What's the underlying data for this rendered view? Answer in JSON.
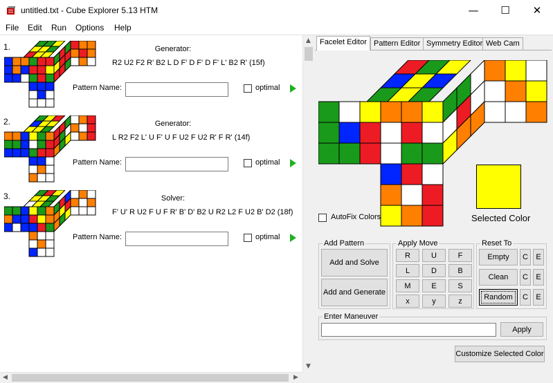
{
  "window": {
    "title": "untitled.txt - Cube Explorer 5.13 HTM",
    "minimize": "—",
    "maximize": "☐",
    "close": "✕"
  },
  "menu": [
    "File",
    "Edit",
    "Run",
    "Options",
    "Help"
  ],
  "colors": {
    "U": "#ffff00",
    "R": "#ed1c24",
    "F": "#1a9a1a",
    "D": "#ffffff",
    "L": "#ff7f00",
    "B": "#0025ff"
  },
  "patterns": [
    {
      "number": "1.",
      "kind": "Generator:",
      "moves": "R2 U2 F2 R' B2 L D F' D F' D F' L' B2 R'  (15f)",
      "name_label": "Pattern Name:",
      "name_value": "",
      "optimal_label": "optimal",
      "optimal_checked": false,
      "preview": {
        "left": [
          "B",
          "O",
          "O",
          "B",
          "O",
          "B",
          "B",
          "B",
          "W"
        ],
        "front": [
          "G",
          "R",
          "R",
          "R",
          "R",
          "Y",
          "G",
          "R",
          "G"
        ],
        "right": [
          "R",
          "O",
          "O",
          "O",
          "R",
          "O",
          "W",
          "O",
          "W"
        ],
        "top": [
          "G",
          "G",
          "Y",
          "Y",
          "Y",
          "G",
          "R",
          "Y",
          "Y"
        ],
        "down": [
          "B",
          "B",
          "B",
          "W",
          "B",
          "W",
          "W",
          "W",
          "W"
        ]
      }
    },
    {
      "number": "2.",
      "kind": "Generator:",
      "moves": "L R2 F2 L' U F' U F U2 F U2 R' F R'  (14f)",
      "name_label": "Pattern Name:",
      "name_value": "",
      "optimal_label": "optimal",
      "optimal_checked": false,
      "preview": {
        "left": [
          "O",
          "O",
          "B",
          "G",
          "G",
          "B",
          "B",
          "B",
          "B"
        ],
        "front": [
          "Y",
          "G",
          "O",
          "W",
          "G",
          "R",
          "G",
          "R",
          "R"
        ],
        "right": [
          "W",
          "O",
          "R",
          "O",
          "W",
          "R",
          "W",
          "O",
          "R"
        ],
        "top": [
          "G",
          "Y",
          "R",
          "B",
          "Y",
          "Y",
          "Y",
          "Y",
          "G"
        ],
        "down": [
          "B",
          "B",
          "W",
          "W",
          "O",
          "W",
          "O",
          "W",
          "W"
        ]
      }
    },
    {
      "number": "3.",
      "kind": "Solver:",
      "moves": "F' U' R U2 F U F R' B' D' B2 U R2 L2 F U2 B' D2  (18f)",
      "name_label": "Pattern Name:",
      "name_value": "",
      "optimal_label": "optimal",
      "optimal_checked": false,
      "preview": {
        "left": [
          "G",
          "G",
          "B",
          "O",
          "B",
          "B",
          "B",
          "W",
          "B"
        ],
        "front": [
          "Y",
          "G",
          "O",
          "R",
          "Y",
          "O",
          "B",
          "R",
          "G"
        ],
        "right": [
          "W",
          "O",
          "W",
          "O",
          "W",
          "O",
          "W",
          "W",
          "W"
        ],
        "top": [
          "G",
          "R",
          "Y",
          "Y",
          "Y",
          "G",
          "W",
          "Y",
          "G"
        ],
        "down": [
          "O",
          "W",
          "W",
          "W",
          "O",
          "W",
          "B",
          "W",
          "W"
        ]
      }
    }
  ],
  "tabs": [
    "Facelet Editor",
    "Pattern Editor",
    "Symmetry Editor",
    "Web Cam"
  ],
  "active_tab": "Facelet Editor",
  "facelet_editor": {
    "left": [
      "G",
      "W",
      "Y",
      "G",
      "B",
      "R",
      "G",
      "G",
      "R"
    ],
    "front": [
      "O",
      "O",
      "Y",
      "W",
      "R",
      "W",
      "W",
      "G",
      "G"
    ],
    "right": [
      "O",
      "Y",
      "W",
      "W",
      "O",
      "Y",
      "W",
      "W",
      "O"
    ],
    "top": [
      "R",
      "G",
      "Y",
      "B",
      "Y",
      "B",
      "G",
      "Y",
      "G"
    ],
    "down": [
      "B",
      "R",
      "W",
      "O",
      "W",
      "R",
      "Y",
      "O",
      "R"
    ],
    "autofix_label": "AutoFix Colors",
    "autofix_checked": false,
    "selected_color_label": "Selected Color",
    "selected_color": "#ffff00"
  },
  "add_pattern": {
    "legend": "Add Pattern",
    "add_and_solve": "Add and Solve",
    "add_and_generate": "Add and Generate"
  },
  "apply_move": {
    "legend": "Apply Move",
    "buttons": [
      "R",
      "U",
      "F",
      "L",
      "D",
      "B",
      "M",
      "E",
      "S",
      "x",
      "y",
      "z"
    ]
  },
  "reset_to": {
    "legend": "Reset To",
    "empty": "Empty",
    "clean": "Clean",
    "random": "Random",
    "c": "C",
    "e": "E"
  },
  "maneuver": {
    "legend": "Enter Maneuver",
    "value": "",
    "apply": "Apply"
  },
  "customize_color": "Customize Selected Color"
}
